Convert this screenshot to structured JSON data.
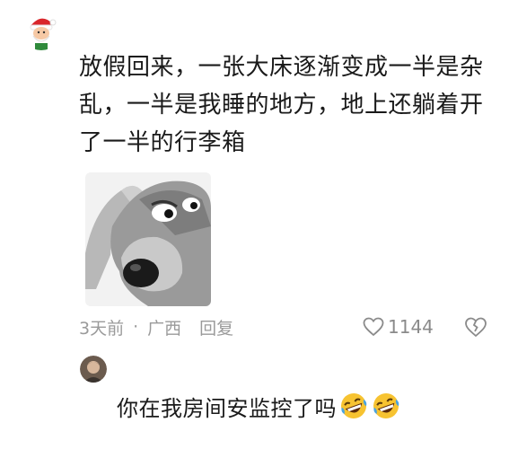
{
  "comment": {
    "text": "放假回来，一张大床逐渐变成一半是杂乱，一半是我睡的地方，地上还躺着开了一半的行李箱",
    "time": "3天前",
    "separator": "·",
    "location": "广西",
    "reply_label": "回复",
    "like_count": "1144",
    "avatar_icon": "santa-avatar-icon",
    "sticker_icon": "wolf-sticker-image"
  },
  "reply": {
    "text": "你在我房间安监控了吗",
    "emoji_icons": [
      "rofl-emoji-icon",
      "rofl-emoji-icon"
    ],
    "avatar_icon": "user-avatar-icon"
  },
  "colors": {
    "meta_gray": "#9a9a9a",
    "text": "#1a1a1a",
    "emoji_yellow": "#f7c331",
    "tears_blue": "#4aa3e0"
  }
}
